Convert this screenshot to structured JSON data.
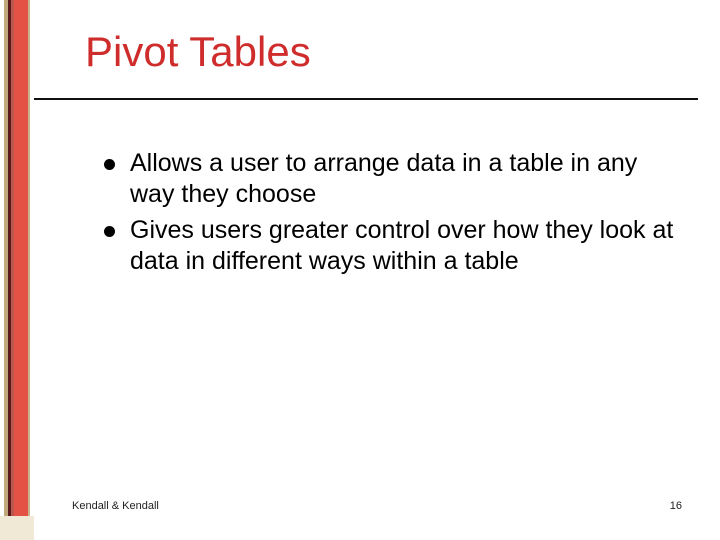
{
  "slide": {
    "title": "Pivot Tables",
    "bullets": [
      "Allows a user to arrange data in a table in any way they choose",
      "Gives users greater control over how they look at data in different ways within a table"
    ],
    "footer": {
      "author": "Kendall & Kendall",
      "page_number": "16"
    }
  }
}
